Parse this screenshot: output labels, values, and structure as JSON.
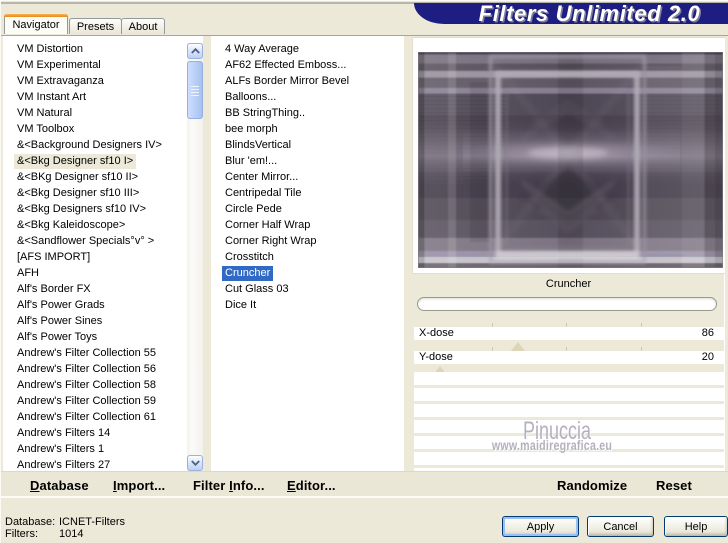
{
  "banner": {
    "title": "Filters Unlimited 2.0",
    "bg": "#1e1e82"
  },
  "tabs": [
    {
      "label": "Navigator",
      "active": true
    },
    {
      "label": "Presets",
      "active": false
    },
    {
      "label": "About",
      "active": false
    }
  ],
  "category_list": {
    "selected": "&<Bkg Designer sf10 I>",
    "items": [
      "VM Distortion",
      "VM Experimental",
      "VM Extravaganza",
      "VM Instant Art",
      "VM Natural",
      "VM Toolbox",
      "&<Background Designers IV>",
      "&<Bkg Designer sf10 I>",
      "&<BKg Designer sf10 II>",
      "&<Bkg Designer sf10 III>",
      "&<Bkg Designers sf10 IV>",
      "&<Bkg Kaleidoscope>",
      "&<Sandflower Specials°v° >",
      "[AFS IMPORT]",
      "AFH",
      "Alf's Border FX",
      "Alf's Power Grads",
      "Alf's Power Sines",
      "Alf's Power Toys",
      "Andrew's Filter Collection 55",
      "Andrew's Filter Collection 56",
      "Andrew's Filter Collection 58",
      "Andrew's Filter Collection 59",
      "Andrew's Filter Collection 61",
      "Andrew's Filters 14",
      "Andrew's Filters 1",
      "Andrew's Filters 27"
    ]
  },
  "filter_list": {
    "selected": "Cruncher",
    "items": [
      "4 Way Average",
      "AF62 Effected Emboss...",
      "ALFs Border Mirror Bevel",
      "Balloons...",
      "BB StringThing..",
      "bee morph",
      "BlindsVertical",
      "Blur 'em!...",
      "Center Mirror...",
      "Centripedal Tile",
      "Circle Pede",
      "Corner Half Wrap",
      "Corner Right Wrap",
      "Crosstitch",
      "Cruncher",
      "Cut Glass 03",
      "Dice It"
    ]
  },
  "preview": {
    "caption": "Cruncher",
    "progress_value": 0
  },
  "parameters": {
    "max": 255,
    "rows": [
      {
        "name": "X-dose",
        "value": 86
      },
      {
        "name": "Y-dose",
        "value": 20
      }
    ],
    "empty_row_count": 7
  },
  "watermark": {
    "line1": "Pinuccia",
    "line2": "www.maidiregrafica.eu"
  },
  "toolbar": [
    {
      "label": "Database",
      "underline": 0
    },
    {
      "label": "Import...",
      "underline": 0
    },
    {
      "label": "Filter Info...",
      "underline": 7
    },
    {
      "label": "Editor...",
      "underline": 0
    }
  ],
  "panel_actions": [
    {
      "label": "Randomize"
    },
    {
      "label": "Reset"
    }
  ],
  "status": {
    "rows": [
      {
        "label": "Database:",
        "value": "ICNET-Filters"
      },
      {
        "label": "Filters:",
        "value": "1014"
      }
    ]
  },
  "buttons": [
    {
      "label": "Apply",
      "default": true
    },
    {
      "label": "Cancel",
      "default": false
    },
    {
      "label": "Help",
      "default": false
    }
  ],
  "colors": {
    "dialog_bg": "#ece9d8",
    "banner_bg": "#1e1e82",
    "selection_blue": "#316ac5",
    "inactive_selection": "#ece9d8",
    "tab_accent_top": "#f9b24e",
    "tab_accent_bottom": "#e8891d",
    "list_bg": "#ffffff"
  }
}
